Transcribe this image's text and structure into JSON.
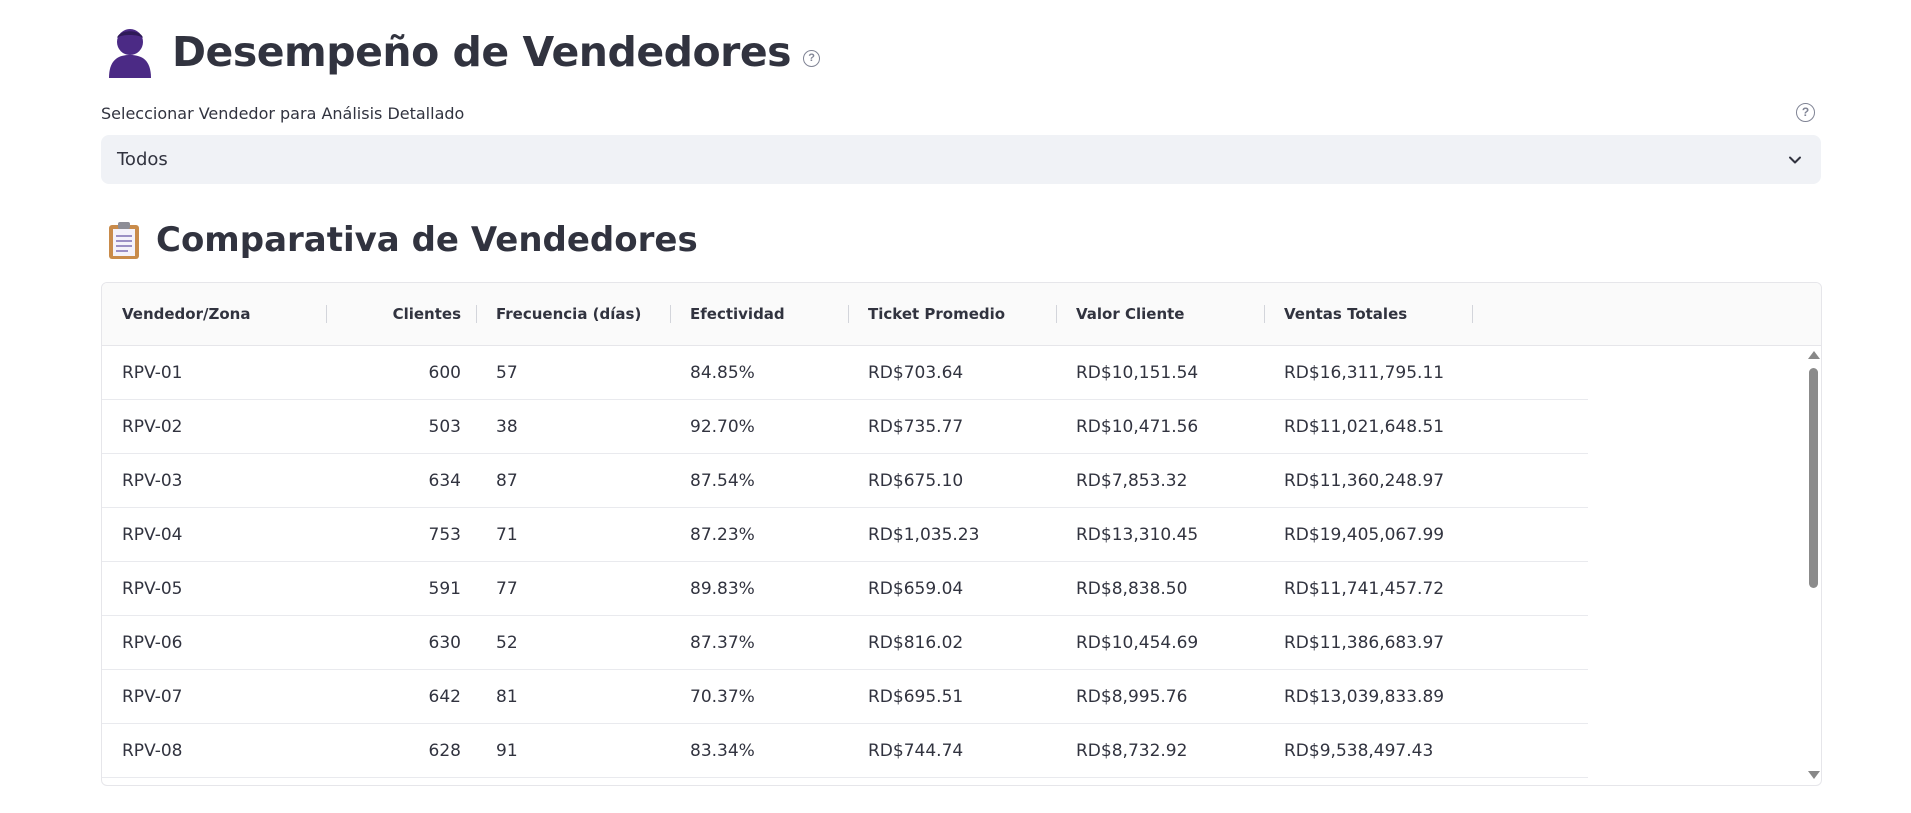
{
  "header": {
    "title": "Desempeño de Vendedores",
    "icon": "user-icon",
    "help": "?"
  },
  "selector": {
    "label": "Seleccionar Vendedor para Análisis Detallado",
    "help": "?",
    "value": "Todos"
  },
  "section": {
    "title": "Comparativa de Vendedores",
    "icon": "clipboard-icon"
  },
  "table": {
    "columns": [
      "Vendedor/Zona",
      "Clientes",
      "Frecuencia (días)",
      "Efectividad",
      "Ticket Promedio",
      "Valor Cliente",
      "Ventas Totales"
    ],
    "rows": [
      [
        "RPV-01",
        "600",
        "57",
        "84.85%",
        "RD$703.64",
        "RD$10,151.54",
        "RD$16,311,795.11"
      ],
      [
        "RPV-02",
        "503",
        "38",
        "92.70%",
        "RD$735.77",
        "RD$10,471.56",
        "RD$11,021,648.51"
      ],
      [
        "RPV-03",
        "634",
        "87",
        "87.54%",
        "RD$675.10",
        "RD$7,853.32",
        "RD$11,360,248.97"
      ],
      [
        "RPV-04",
        "753",
        "71",
        "87.23%",
        "RD$1,035.23",
        "RD$13,310.45",
        "RD$19,405,067.99"
      ],
      [
        "RPV-05",
        "591",
        "77",
        "89.83%",
        "RD$659.04",
        "RD$8,838.50",
        "RD$11,741,457.72"
      ],
      [
        "RPV-06",
        "630",
        "52",
        "87.37%",
        "RD$816.02",
        "RD$10,454.69",
        "RD$11,386,683.97"
      ],
      [
        "RPV-07",
        "642",
        "81",
        "70.37%",
        "RD$695.51",
        "RD$8,995.76",
        "RD$13,039,833.89"
      ],
      [
        "RPV-08",
        "628",
        "91",
        "83.34%",
        "RD$744.74",
        "RD$8,732.92",
        "RD$9,538,497.43"
      ]
    ]
  },
  "colors": {
    "text": "#31333f",
    "select_bg": "#f0f2f6",
    "header_bg": "#fafafa",
    "icon_purple": "#4b2a85"
  }
}
